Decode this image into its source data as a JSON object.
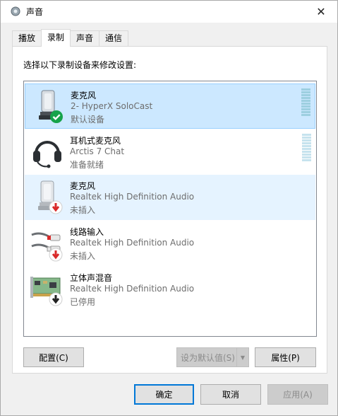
{
  "window": {
    "title": "声音",
    "close_glyph": "✕"
  },
  "tabs": [
    {
      "label": "播放",
      "active": false
    },
    {
      "label": "录制",
      "active": true
    },
    {
      "label": "声音",
      "active": false
    },
    {
      "label": "通信",
      "active": false
    }
  ],
  "instruction": "选择以下录制设备来修改设置:",
  "devices": [
    {
      "name": "麦克风",
      "description": "2- HyperX SoloCast",
      "status": "默认设备",
      "icon": "microphone-icon",
      "badge": "check-badge-icon",
      "state": "selected"
    },
    {
      "name": "耳机式麦克风",
      "description": "Arctis 7 Chat",
      "status": "准备就绪",
      "icon": "headset-icon",
      "badge": "",
      "state": "normal"
    },
    {
      "name": "麦克风",
      "description": "Realtek High Definition Audio",
      "status": "未插入",
      "icon": "microphone-icon",
      "badge": "unplugged-badge-icon",
      "state": "hover"
    },
    {
      "name": "线路输入",
      "description": "Realtek High Definition Audio",
      "status": "未插入",
      "icon": "line-in-icon",
      "badge": "unplugged-badge-icon",
      "state": "normal"
    },
    {
      "name": "立体声混音",
      "description": "Realtek High Definition Audio",
      "status": "已停用",
      "icon": "sound-card-icon",
      "badge": "disabled-badge-icon",
      "state": "normal"
    }
  ],
  "buttons": {
    "configure": "配置(C)",
    "set_default": "设为默认值(S)",
    "properties": "属性(P)",
    "ok": "确定",
    "cancel": "取消",
    "apply": "应用(A)"
  },
  "colors": {
    "selection": "#cce8ff",
    "hover": "#e5f3ff",
    "accent": "#0078d7",
    "check_green": "#16a34a",
    "arrow_red": "#d92b2b"
  }
}
